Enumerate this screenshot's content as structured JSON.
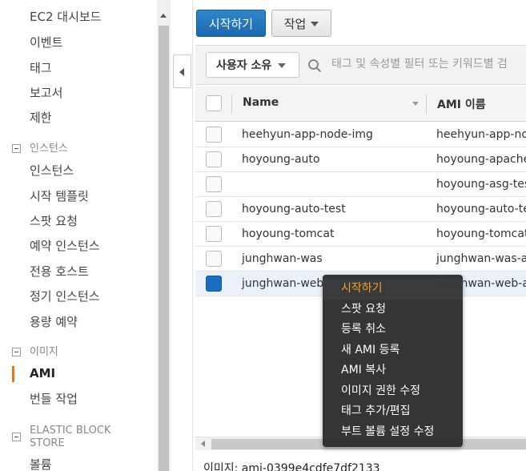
{
  "sidebar": {
    "top_items": [
      "EC2 대시보드",
      "이벤트",
      "태그",
      "보고서",
      "제한"
    ],
    "instances_section": "인스턴스",
    "instances_items": [
      "인스턴스",
      "시작 템플릿",
      "스팟 요청",
      "예약 인스턴스",
      "전용 호스트",
      "정기 인스턴스",
      "용량 예약"
    ],
    "images_section": "이미지",
    "images_items": [
      "AMI",
      "번들 작업"
    ],
    "ebs_section": "ELASTIC BLOCK STORE",
    "ebs_items": [
      "볼륨"
    ],
    "active_item": "AMI"
  },
  "toolbar": {
    "launch_label": "시작하기",
    "actions_label": "작업"
  },
  "filter": {
    "owner_label": "사용자 소유",
    "search_placeholder": "태그 및 속성별 필터 또는 키워드별 검"
  },
  "table": {
    "columns": [
      "Name",
      "AMI 이름"
    ],
    "rows": [
      {
        "name": "heehyun-app-node-img",
        "ami": "heehyun-app-node"
      },
      {
        "name": "hoyoung-auto",
        "ami": "hoyoung-apache-"
      },
      {
        "name": "",
        "ami": "hoyoung-asg-test"
      },
      {
        "name": "hoyoung-auto-test",
        "ami": "hoyoung-auto-tes"
      },
      {
        "name": "hoyoung-tomcat",
        "ami": "hoyoung-tomcat"
      },
      {
        "name": "junghwan-was",
        "ami": "junghwan-was-am"
      },
      {
        "name": "junghwan-web",
        "ami": "junghwan-web-am"
      }
    ],
    "selected_row": 6
  },
  "context_menu": {
    "items": [
      "시작하기",
      "스팟 요청",
      "등록 취소",
      "새 AMI 등록",
      "AMI 복사",
      "이미지 권한 수정",
      "태그 추가/편집",
      "부트 볼륨 설정 수정"
    ],
    "highlighted": 0
  },
  "details": {
    "label": "이미지: ami-0399e4cdfe7df2133"
  },
  "colors": {
    "accent": "#ec7211",
    "primary_button": "#1a69b0",
    "menu_highlight": "#f7a02a"
  }
}
